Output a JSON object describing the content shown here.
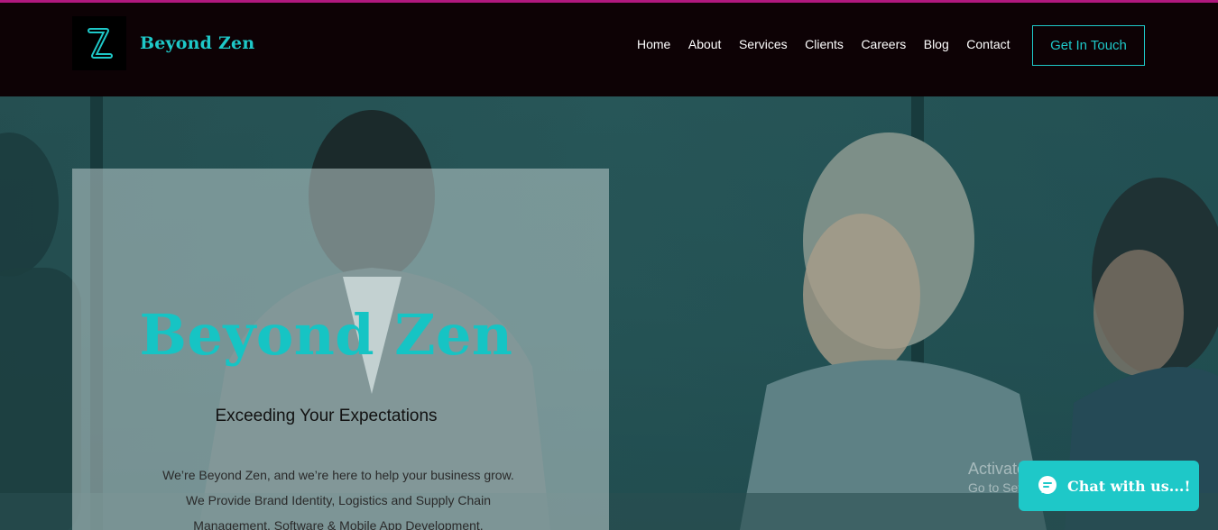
{
  "header": {
    "brand": "Beyond Zen",
    "logo_icon": "z-logo-icon",
    "nav": [
      "Home",
      "About",
      "Services",
      "Clients",
      "Careers",
      "Blog",
      "Contact"
    ],
    "cta_label": "Get In Touch"
  },
  "hero": {
    "title": "Beyond Zen",
    "subtitle": "Exceeding Your Expectations",
    "body": "We’re Beyond Zen, and we’re here to help your business grow. We Provide Brand Identity, Logistics and Supply Chain Management, Software & Mobile App Development,"
  },
  "watermark": {
    "line1": "Activate Windows",
    "line2": "Go to Settings to activate Windows."
  },
  "chat": {
    "label": "Chat with us...!",
    "icon": "chat-bubble-icon"
  },
  "colors": {
    "accent": "#1ec8c8",
    "header_bg": "#0d0205",
    "top_border": "#b0187e"
  }
}
